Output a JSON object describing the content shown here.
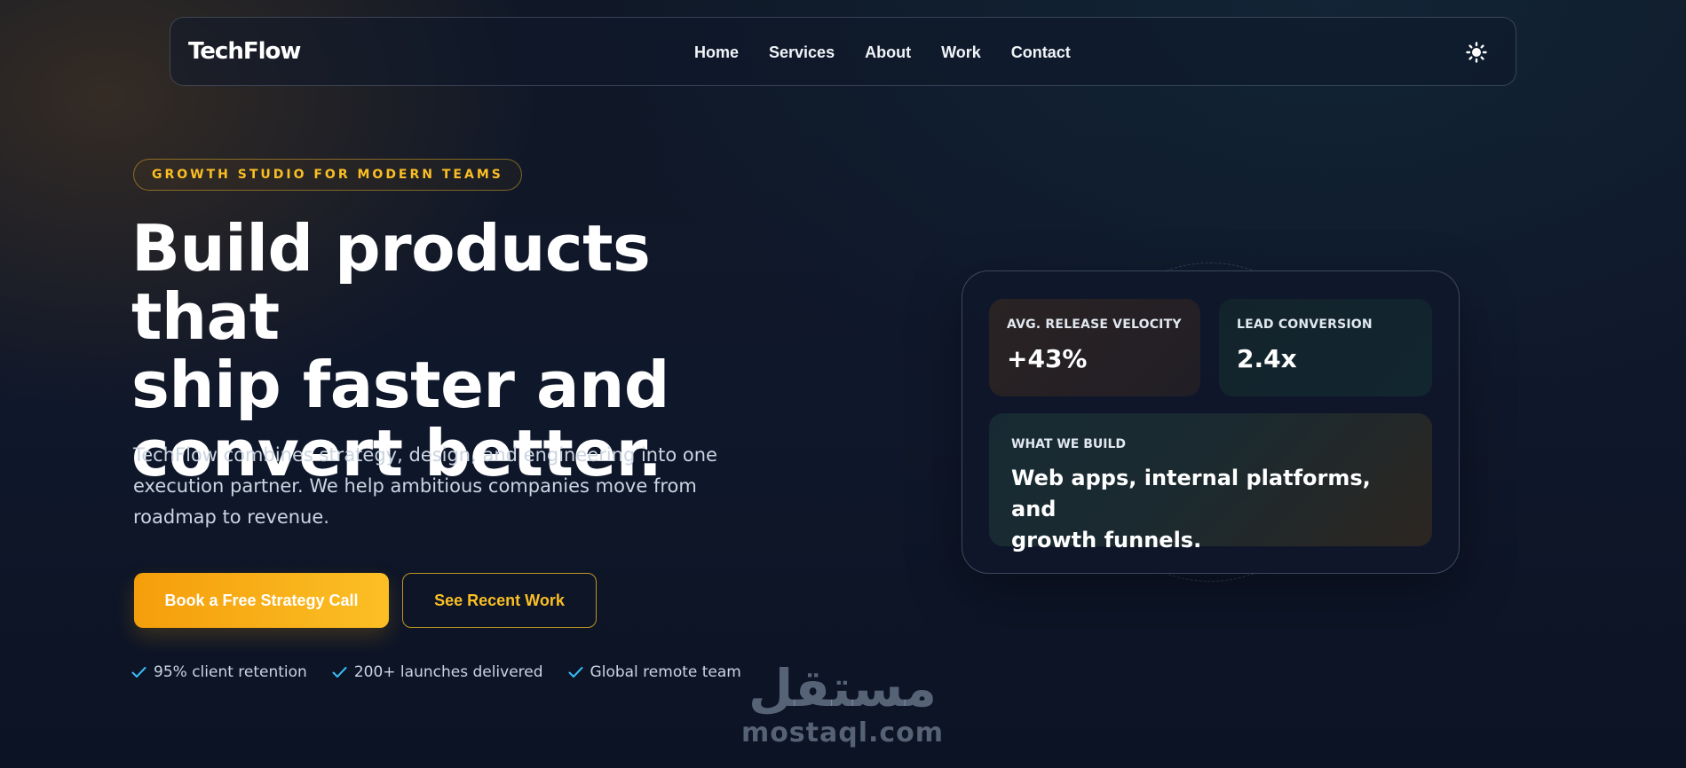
{
  "nav": {
    "brand": "TechFlow",
    "links": [
      "Home",
      "Services",
      "About",
      "Work",
      "Contact"
    ],
    "theme_toggle_icon": "sun-icon"
  },
  "hero": {
    "eyebrow": "GROWTH STUDIO FOR MODERN TEAMS",
    "headline_lines": [
      "Build products that",
      "ship faster and",
      "convert better."
    ],
    "lede_lines": [
      "TechFlow combines strategy, design, and engineering into one",
      "execution partner. We help ambitious companies move from",
      "roadmap to revenue."
    ],
    "primary_cta": "Book a Free Strategy Call",
    "secondary_cta": "See Recent Work",
    "proof_points": [
      "95% client retention",
      "200+ launches delivered",
      "Global remote team"
    ],
    "proof_icon": "check-icon"
  },
  "metrics_card": {
    "stats": [
      {
        "label": "AVG. RELEASE VELOCITY",
        "value": "+43%"
      },
      {
        "label": "LEAD CONVERSION",
        "value": "2.4x"
      }
    ],
    "build": {
      "label": "WHAT WE BUILD",
      "text_lines": [
        "Web apps, internal platforms, and",
        "growth funnels."
      ]
    }
  },
  "watermark": {
    "arabic": "مستقل",
    "latin": "mostaql.com"
  },
  "colors": {
    "accent": "#fbbf24",
    "accent_deep": "#f59e0b",
    "background": "#0f172a",
    "check": "#38bdf8"
  }
}
